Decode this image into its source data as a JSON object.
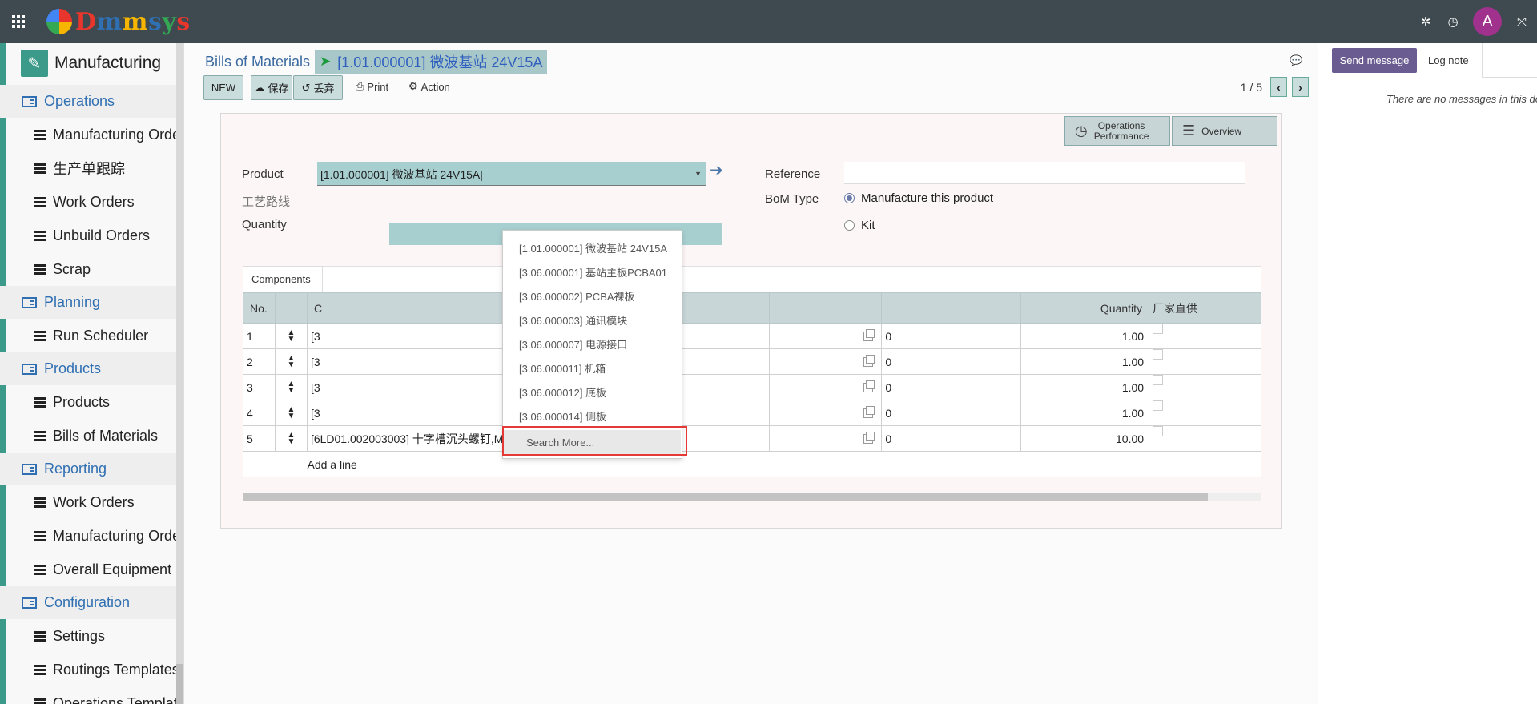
{
  "navbar": {
    "logo_text": "Dmmsys",
    "logo_colors": [
      "#e8362d",
      "#2f6fb2",
      "#f7b500",
      "#2f6fb2",
      "#34a853",
      "#e8362d"
    ],
    "avatar_letter": "A",
    "icons": [
      "apps-icon",
      "bug-icon",
      "clock-icon",
      "expand-icon"
    ]
  },
  "sidebar": {
    "app_title": "Manufacturing",
    "menu": [
      {
        "type": "section",
        "label": "Operations"
      },
      {
        "type": "item",
        "label": "Manufacturing Orders"
      },
      {
        "type": "item",
        "label": "生产单跟踪"
      },
      {
        "type": "item",
        "label": "Work Orders"
      },
      {
        "type": "item",
        "label": "Unbuild Orders"
      },
      {
        "type": "item",
        "label": "Scrap"
      },
      {
        "type": "section",
        "label": "Planning"
      },
      {
        "type": "item",
        "label": "Run Scheduler"
      },
      {
        "type": "section",
        "label": "Products"
      },
      {
        "type": "item",
        "label": "Products"
      },
      {
        "type": "item",
        "label": "Bills of Materials"
      },
      {
        "type": "section",
        "label": "Reporting"
      },
      {
        "type": "item",
        "label": "Work Orders"
      },
      {
        "type": "item",
        "label": "Manufacturing Orders"
      },
      {
        "type": "item",
        "label": "Overall Equipment Effectiveness"
      },
      {
        "type": "section",
        "label": "Configuration"
      },
      {
        "type": "item",
        "label": "Settings"
      },
      {
        "type": "item",
        "label": "Routings Templates"
      },
      {
        "type": "item",
        "label": "Operations Templates"
      }
    ]
  },
  "breadcrumb": {
    "root": "Bills of Materials",
    "current": "[1.01.000001] 微波基站 24V15A"
  },
  "toolbar": {
    "new_label": "NEW",
    "save_label": "保存",
    "discard_label": "丢弃",
    "print_label": "Print",
    "action_label": "Action",
    "pager": "1 / 5"
  },
  "smart_buttons": {
    "operations_line1": "Operations",
    "operations_line2": "Performance",
    "overview": "Overview"
  },
  "form": {
    "product_label": "Product",
    "product_value": "[1.01.000001] 微波基站 24V15A",
    "routing_label": "工艺路线",
    "quantity_label": "Quantity",
    "reference_label": "Reference",
    "bom_type_label": "BoM Type",
    "bom_type_options": [
      "Manufacture this product",
      "Kit"
    ],
    "bom_type_selected": "Manufacture this product"
  },
  "dropdown": {
    "items": [
      "[1.01.000001] 微波基站 24V15A",
      "[3.06.000001] 基站主板PCBA01",
      "[3.06.000002] PCBA裸板",
      "[3.06.000003] 通讯模块",
      "[3.06.000007] 电源接口",
      "[3.06.000011] 机箱",
      "[3.06.000012] 底板",
      "[3.06.000014] 侧板"
    ],
    "search_more": "Search More..."
  },
  "components": {
    "tab_label": "Components",
    "headers": {
      "no": "No.",
      "component": "C",
      "quantity": "Quantity",
      "vendor_supply": "厂家直供"
    },
    "rows": [
      {
        "no": "1",
        "component": "[3",
        "col3": "0",
        "qty": "1.00"
      },
      {
        "no": "2",
        "component": "[3",
        "col3": "0",
        "qty": "1.00"
      },
      {
        "no": "3",
        "component": "[3",
        "col3": "0",
        "qty": "1.00"
      },
      {
        "no": "4",
        "component": "[3",
        "col3": "0",
        "qty": "1.00"
      },
      {
        "no": "5",
        "component": "[6LD01.002003003] 十字槽沉头螺钉,M2,5,4.8 级",
        "col3": "0",
        "qty": "10.00"
      }
    ],
    "add_line": "Add a line"
  },
  "chatter": {
    "send_message": "Send message",
    "log_note": "Log note",
    "empty": "There are no messages in this document."
  },
  "watermark_text": "Dmmsys",
  "colors": {
    "navbar": "#3e4a4f",
    "accent": "#3b9a8a",
    "link": "#2f6fb2",
    "highlight": "#e53935",
    "send_button": "#6a5c90"
  }
}
